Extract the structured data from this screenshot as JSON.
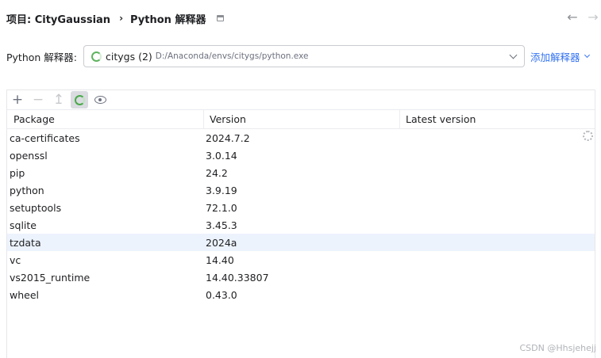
{
  "header": {
    "project_label": "项目: CityGaussian",
    "separator": "›",
    "page_title": "Python 解释器",
    "back_arrow": "←",
    "forward_arrow": "→"
  },
  "interpreter": {
    "label": "Python 解释器:",
    "name": "citygs (2)",
    "path": "D:/Anaconda/envs/citygs/python.exe",
    "add_label": "添加解释器"
  },
  "toolbar": {
    "add": "+",
    "remove": "−",
    "upgrade": "↥"
  },
  "table": {
    "headers": [
      "Package",
      "Version",
      "Latest version"
    ],
    "rows": [
      {
        "package": "ca-certificates",
        "version": "2024.7.2",
        "latest": ""
      },
      {
        "package": "openssl",
        "version": "3.0.14",
        "latest": ""
      },
      {
        "package": "pip",
        "version": "24.2",
        "latest": ""
      },
      {
        "package": "python",
        "version": "3.9.19",
        "latest": ""
      },
      {
        "package": "setuptools",
        "version": "72.1.0",
        "latest": ""
      },
      {
        "package": "sqlite",
        "version": "3.45.3",
        "latest": ""
      },
      {
        "package": "tzdata",
        "version": "2024a",
        "latest": ""
      },
      {
        "package": "vc",
        "version": "14.40",
        "latest": ""
      },
      {
        "package": "vs2015_runtime",
        "version": "14.40.33807",
        "latest": ""
      },
      {
        "package": "wheel",
        "version": "0.43.0",
        "latest": ""
      }
    ],
    "selected_row": 6
  },
  "watermark": "CSDN @Hhsjehejj",
  "colors": {
    "accent": "#3574f0",
    "selection": "#edf3fd",
    "spinner": "#5fb35f"
  }
}
